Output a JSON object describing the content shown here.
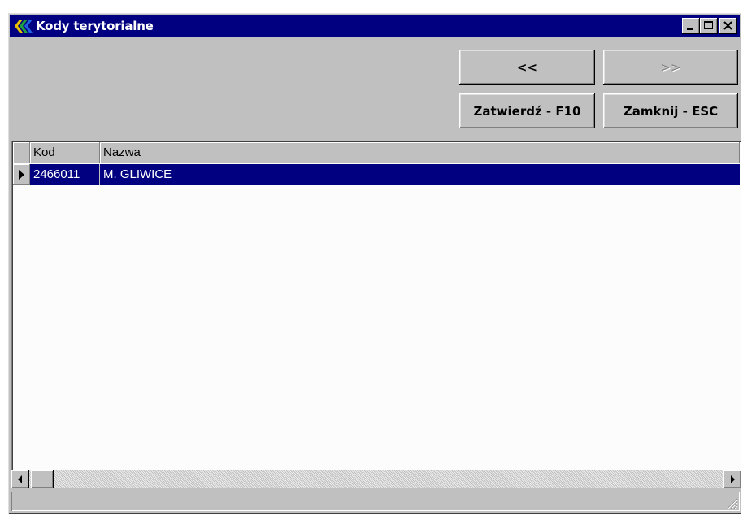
{
  "window": {
    "title": "Kody terytorialne",
    "controls": {
      "minimize": "minimize-icon",
      "maximize": "maximize-icon",
      "close": "close-icon"
    }
  },
  "toolbar": {
    "prev_label": "<<",
    "next_label": ">>",
    "next_enabled": false,
    "confirm_label": "Zatwierdź - F10",
    "close_label": "Zamknij - ESC"
  },
  "grid": {
    "columns": [
      "Kod",
      "Nazwa"
    ],
    "rows": [
      {
        "kod": "2466011",
        "nazwa": "M. GLIWICE",
        "selected": true
      }
    ]
  },
  "colors": {
    "titlebar": "#000080",
    "selection": "#000080",
    "face": "#c0c0c0"
  }
}
